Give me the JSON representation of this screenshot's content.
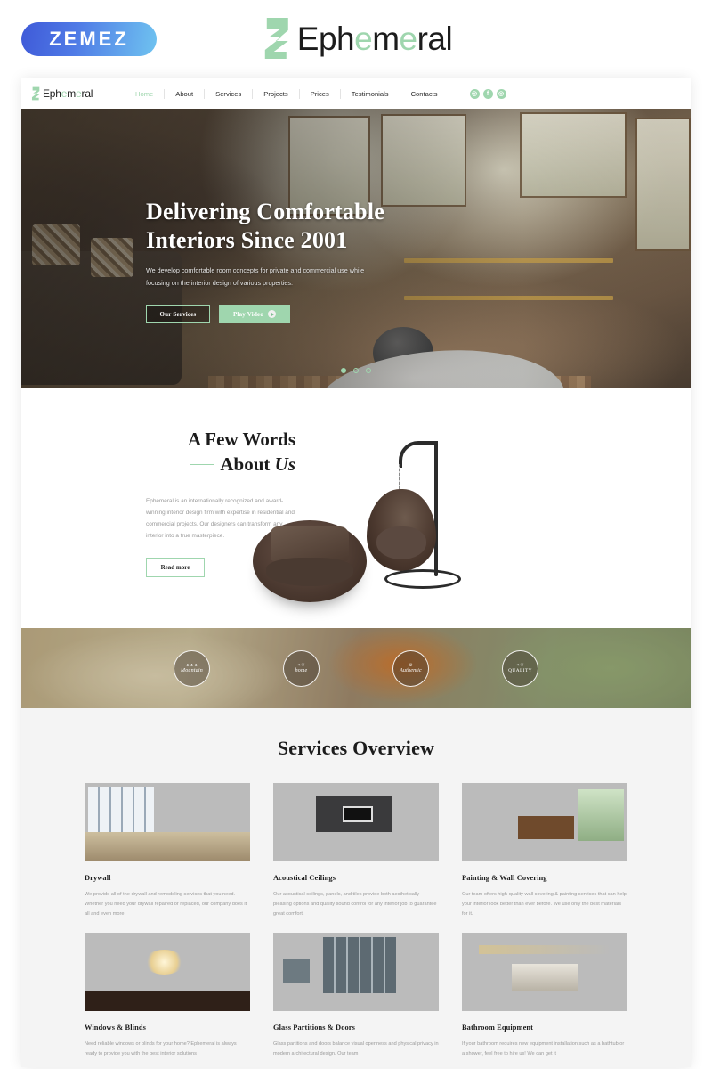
{
  "topbar": {
    "zemez_label": "ZEMEZ",
    "brand_parts": [
      {
        "t": "Eph",
        "green": false
      },
      {
        "t": "e",
        "green": true
      },
      {
        "t": "m",
        "green": false
      },
      {
        "t": "e",
        "green": true
      },
      {
        "t": "ral",
        "green": false
      }
    ],
    "brand_full": "Ephemeral"
  },
  "nav": {
    "brand": "Ephemeral",
    "links": [
      {
        "label": "Home",
        "active": true
      },
      {
        "label": "About",
        "active": false
      },
      {
        "label": "Services",
        "active": false
      },
      {
        "label": "Projects",
        "active": false
      },
      {
        "label": "Prices",
        "active": false
      },
      {
        "label": "Testimonials",
        "active": false
      },
      {
        "label": "Contacts",
        "active": false
      }
    ],
    "social": [
      {
        "name": "instagram-icon",
        "glyph": "◎"
      },
      {
        "name": "facebook-icon",
        "glyph": "f"
      },
      {
        "name": "google-plus-icon",
        "glyph": "◎"
      }
    ]
  },
  "hero": {
    "title_line1": "Delivering Comfortable",
    "title_line2": "Interiors Since 2001",
    "subtitle": "We develop comfortable room concepts for private and commercial use while focusing on the interior design of various properties.",
    "primary_button": "Our Services",
    "secondary_button": "Play Video",
    "slides": 3,
    "active_slide": 1
  },
  "about": {
    "heading_line1": "A Few Words",
    "heading_line2_prefix": "About",
    "heading_line2_italic": "Us",
    "paragraph": "Ephemeral is an internationally recognized and award-winning interior design firm with expertise in residential and commercial projects. Our designers can transform any interior into a true masterpiece.",
    "button": "Read more"
  },
  "badges": [
    {
      "name": "mountain-badge",
      "text": "Mountain",
      "ornament": "♣ ♣ ♣",
      "style": "script"
    },
    {
      "name": "home-badge",
      "text": "home",
      "ornament": "❧❦",
      "style": "script"
    },
    {
      "name": "authentic-badge",
      "text": "Authentic",
      "ornament": "♛",
      "style": "script"
    },
    {
      "name": "quality-badge",
      "text": "QUALITY",
      "ornament": "❧❦",
      "style": "upper"
    }
  ],
  "services": {
    "title": "Services Overview",
    "cards": [
      {
        "thumb": "living-room-photo",
        "title": "Drywall",
        "text": "We provide all of the drywall and remodeling services that you need. Whether you need your drywall repaired or replaced, our company does it all and even more!"
      },
      {
        "thumb": "modern-lounge-photo",
        "title": "Acoustical Ceilings",
        "text": "Our acoustical ceilings, panels, and tiles provide both aesthetically-pleasing options and quality sound control for any interior job to guarantee great comfort."
      },
      {
        "thumb": "kitchen-dining-photo",
        "title": "Painting & Wall Covering",
        "text": "Our team offers high-quality wall covering & painting services that can help your interior look better than ever before. We use only the best materials for it."
      },
      {
        "thumb": "attic-bedroom-photo",
        "title": "Windows & Blinds",
        "text": "Need reliable windows or blinds for your home? Ephemeral is always ready to provide you with the best interior solutions"
      },
      {
        "thumb": "glass-partition-photo",
        "title": "Glass Partitions & Doors",
        "text": "Glass partitions and doors balance visual openness and physical privacy in modern architectural design. Our team"
      },
      {
        "thumb": "dark-bathroom-photo",
        "title": "Bathroom Equipment",
        "text": "If your bathroom requires new equipment installation such as a bathtub or a shower, feel free to hire us! We can get it"
      }
    ]
  },
  "colors": {
    "accent_green": "#9fd6ae",
    "text_dark": "#1c1c1c",
    "text_muted": "#9a9a9a",
    "services_bg": "#f4f4f4"
  }
}
